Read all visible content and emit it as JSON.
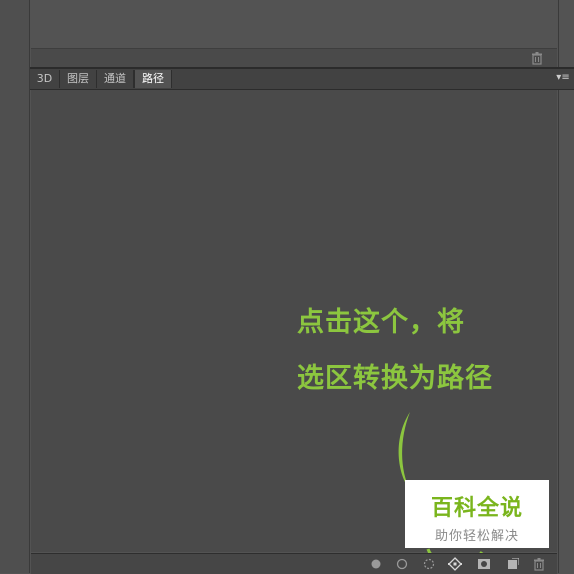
{
  "tabs": [
    {
      "label": "3D",
      "active": false
    },
    {
      "label": "图层",
      "active": false
    },
    {
      "label": "通道",
      "active": false
    },
    {
      "label": "路径",
      "active": true
    }
  ],
  "annotation": {
    "line1": "点击这个，将",
    "line2": "选区转换为路径",
    "color": "#8cc63f"
  },
  "watermark": {
    "title": "百科全说",
    "subtitle": "助你轻松解决"
  },
  "bottom_toolbar": [
    "fill-path-icon",
    "stroke-path-icon",
    "load-selection-icon",
    "make-work-path-icon",
    "add-mask-icon",
    "new-path-icon",
    "delete-path-icon"
  ],
  "top_panel_toolbar": [
    "delete-icon"
  ],
  "colors": {
    "panel_bg": "#4a4a4a",
    "tabbar_bg": "#424242",
    "active_tab_bg": "#535353",
    "accent_green": "#8cc63f"
  }
}
